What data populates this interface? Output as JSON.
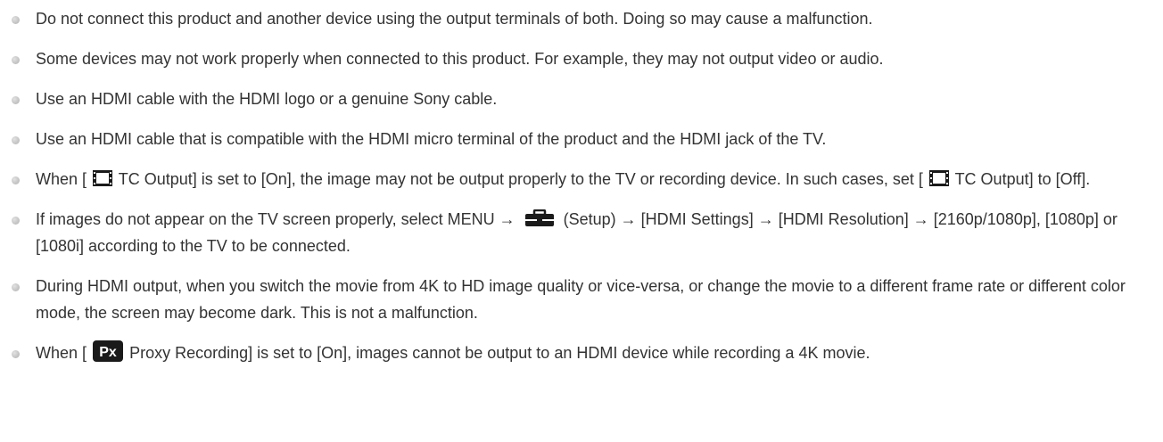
{
  "notes": [
    {
      "text": "Do not connect this product and another device using the output terminals of both. Doing so may cause a malfunction."
    },
    {
      "text": "Some devices may not work properly when connected to this product. For example, they may not output video or audio."
    },
    {
      "text": "Use an HDMI cable with the HDMI logo or a genuine Sony cable."
    },
    {
      "text": "Use an HDMI cable that is compatible with the HDMI micro terminal of the product and the HDMI jack of the TV."
    },
    {
      "part1": "When [",
      "part2": "TC Output] is set to [On], the image may not be output properly to the TV or recording device. In such cases, set [",
      "part3": "TC Output] to [Off]."
    },
    {
      "part1": "If images do not appear on the TV screen properly, select MENU →",
      "part2": "(Setup) → [HDMI Settings] → [HDMI Resolution] → [2160p/1080p], [1080p] or [1080i] according to the TV to be connected."
    },
    {
      "text": "During HDMI output, when you switch the movie from 4K to HD image quality or vice-versa, or change the movie to a different frame rate or different color mode, the screen may become dark. This is not a malfunction."
    },
    {
      "part1": "When [",
      "icon_text": "Px",
      "part2": "Proxy Recording] is set to [On], images cannot be output to an HDMI device while recording a 4K movie."
    }
  ],
  "icons": {
    "bullet": "bullet-dot",
    "movie": "movie-frame-icon",
    "setup": "toolbox-icon",
    "proxy": "px-badge-icon"
  },
  "colors": {
    "text": "#333333",
    "bullet": "#c4c4c4",
    "icon": "#1a1a1a"
  }
}
